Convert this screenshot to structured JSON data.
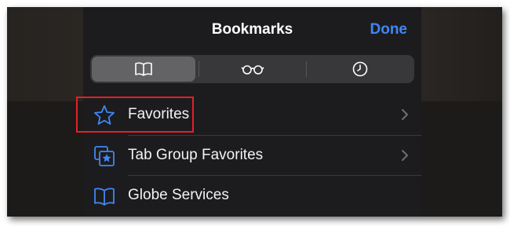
{
  "header": {
    "title": "Bookmarks",
    "done_label": "Done"
  },
  "segments": [
    {
      "icon": "book-icon",
      "selected": true
    },
    {
      "icon": "reading-glasses-icon",
      "selected": false
    },
    {
      "icon": "clock-icon",
      "selected": false
    }
  ],
  "list": [
    {
      "label": "Favorites",
      "icon": "star-icon",
      "has_chevron": true,
      "highlighted": true
    },
    {
      "label": "Tab Group Favorites",
      "icon": "tab-group-star-icon",
      "has_chevron": true
    },
    {
      "label": "Globe Services",
      "icon": "book-icon",
      "has_chevron": false
    }
  ],
  "colors": {
    "accent": "#3f87f5",
    "highlight_box": "#e3202a",
    "sheet_bg": "#1c1c1e"
  }
}
